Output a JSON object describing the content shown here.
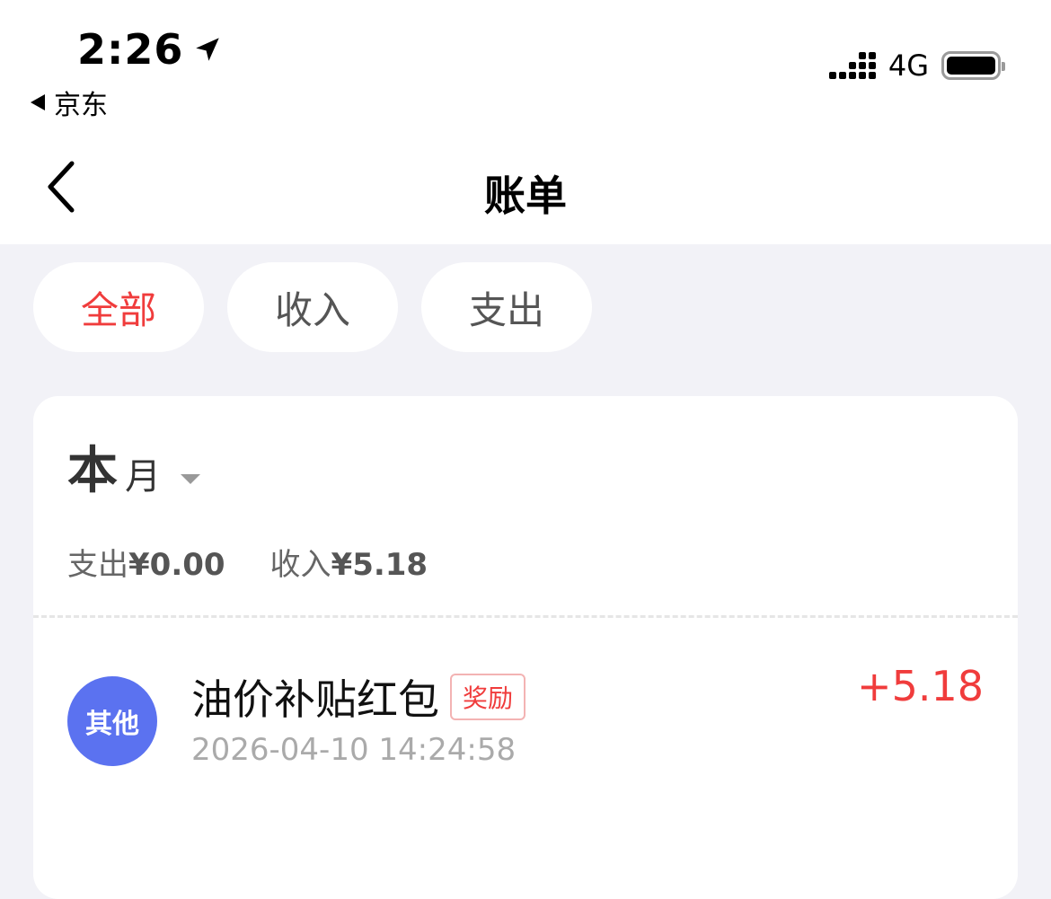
{
  "status_bar": {
    "time": "2:26",
    "back_app": "京东",
    "network": "4G"
  },
  "nav": {
    "title": "账单"
  },
  "tabs": [
    {
      "label": "全部",
      "active": true
    },
    {
      "label": "收入",
      "active": false
    },
    {
      "label": "支出",
      "active": false
    }
  ],
  "period": {
    "big": "本",
    "small": "月"
  },
  "summary": {
    "expense_label": "支出",
    "expense_value": "¥0.00",
    "income_label": "收入",
    "income_value": "¥5.18"
  },
  "records": [
    {
      "avatar_label": "其他",
      "title": "油价补贴红包",
      "tag": "奖励",
      "time": "2026-04-10 14:24:58",
      "amount": "+5.18"
    }
  ],
  "colors": {
    "accent_red": "#f03c3c",
    "avatar_blue": "#5b72f0",
    "background": "#f2f2f7"
  },
  "icons": {
    "location": "location-arrow-icon",
    "back_app": "triangle-left-icon",
    "signal": "cellular-signal-icon",
    "battery": "battery-icon",
    "nav_back": "chevron-left-icon",
    "caret": "caret-down-icon"
  }
}
